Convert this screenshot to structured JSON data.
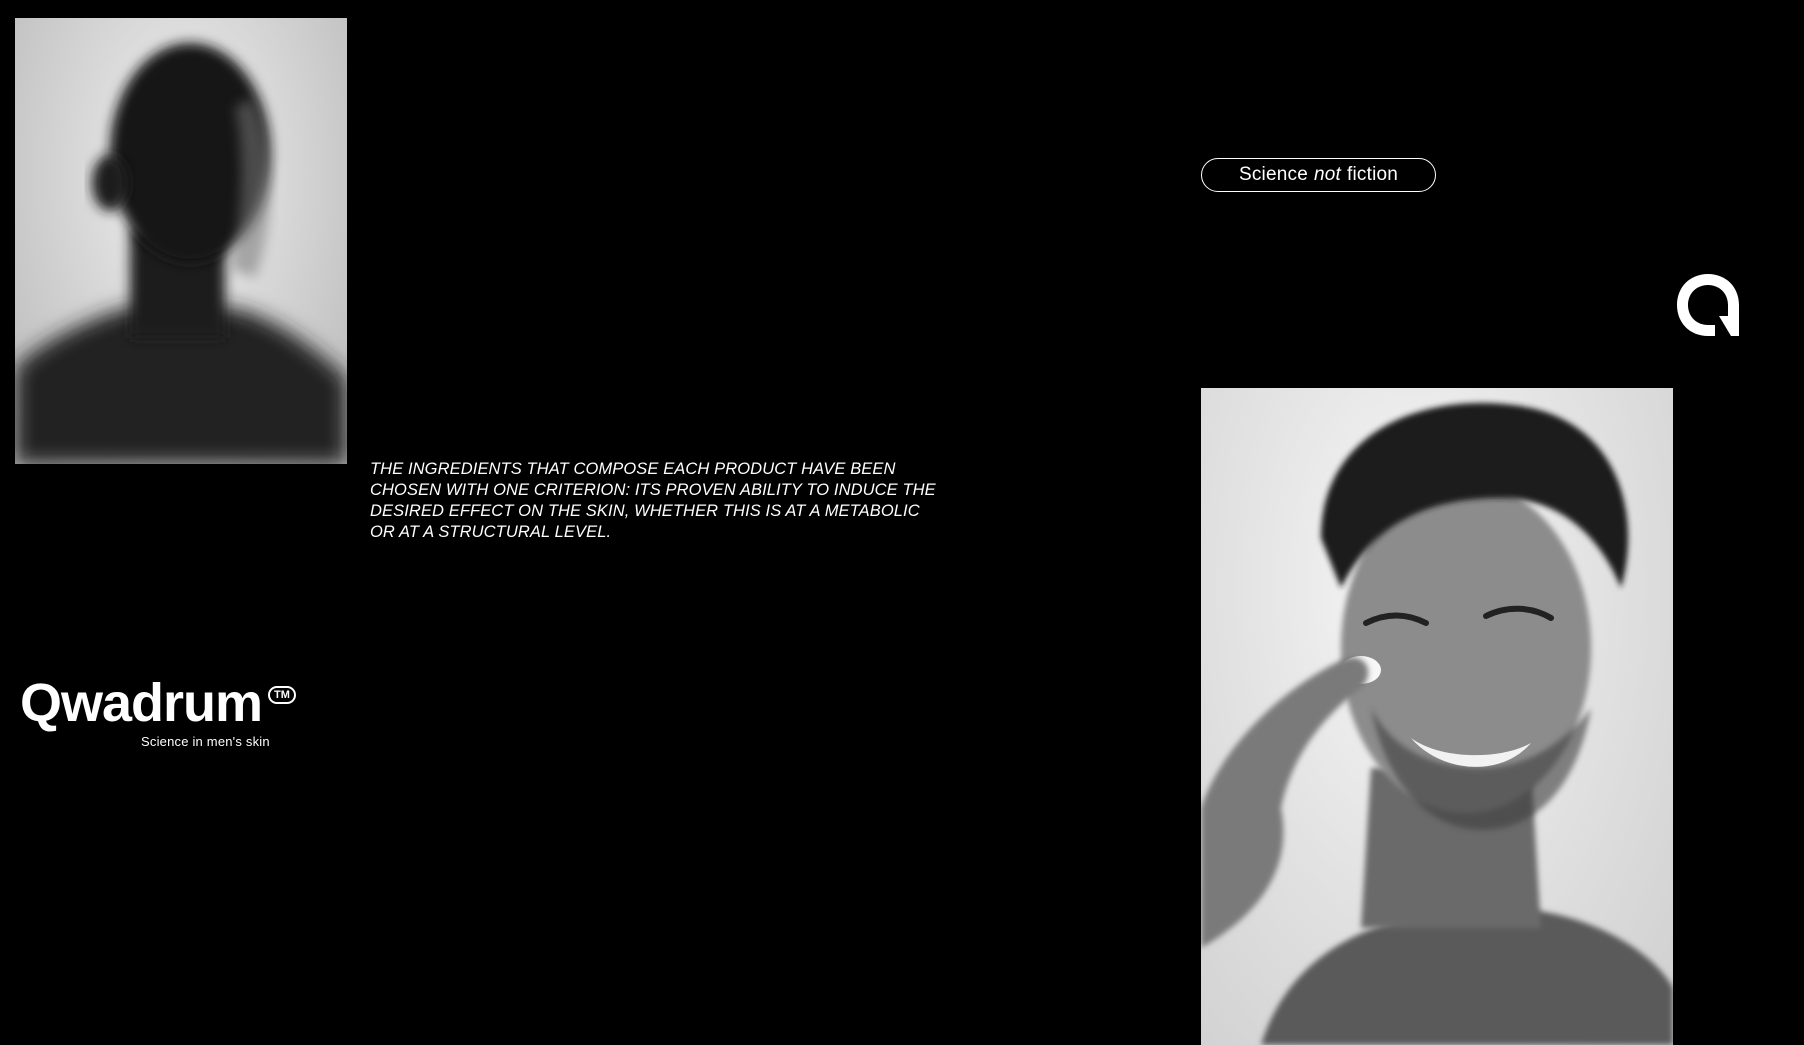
{
  "tagline": {
    "before": "Science",
    "emphasis": "not",
    "after": "fiction"
  },
  "description": "THE INGREDIENTS THAT COMPOSE EACH PRODUCT HAVE BEEN CHOSEN WITH ONE CRITERION: ITS PROVEN ABILITY TO INDUCE THE DESIRED EFFECT ON THE SKIN, WHETHER THIS IS AT A METABOLIC OR AT A STRUCTURAL LEVEL.",
  "logo": {
    "word": "Qwadrum",
    "tm": "TM",
    "subtitle": "Science in men's skin"
  },
  "photos": {
    "left_alt": "blurred silhouette portrait",
    "right_alt": "man winking and applying cream"
  },
  "colors": {
    "background": "#000000",
    "foreground": "#ffffff"
  },
  "icons": {
    "brand": "brand-q-icon"
  }
}
